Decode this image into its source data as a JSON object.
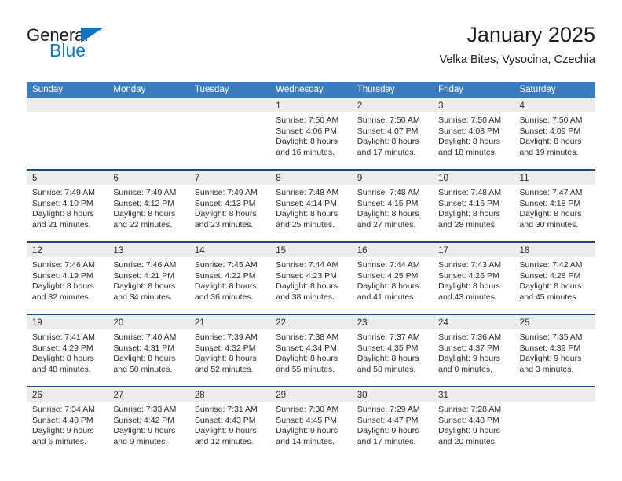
{
  "logo": {
    "word_top": "General",
    "word_bottom": "Blue",
    "triangle_color": "#1574bb",
    "blue_color": "#1574bb"
  },
  "header": {
    "title": "January 2025",
    "subtitle": "Velka Bites, Vysocina, Czechia"
  },
  "theme": {
    "header_bar": "#3a7cbe",
    "row_divider": "#1f4e79",
    "day_head_bg": "#ececec"
  },
  "calendar": {
    "weekday_headers": [
      "Sunday",
      "Monday",
      "Tuesday",
      "Wednesday",
      "Thursday",
      "Friday",
      "Saturday"
    ],
    "weeks": [
      [
        {
          "day": "",
          "empty": true
        },
        {
          "day": "",
          "empty": true
        },
        {
          "day": "",
          "empty": true
        },
        {
          "day": "1",
          "sunrise": "Sunrise: 7:50 AM",
          "sunset": "Sunset: 4:06 PM",
          "daylight1": "Daylight: 8 hours",
          "daylight2": "and 16 minutes."
        },
        {
          "day": "2",
          "sunrise": "Sunrise: 7:50 AM",
          "sunset": "Sunset: 4:07 PM",
          "daylight1": "Daylight: 8 hours",
          "daylight2": "and 17 minutes."
        },
        {
          "day": "3",
          "sunrise": "Sunrise: 7:50 AM",
          "sunset": "Sunset: 4:08 PM",
          "daylight1": "Daylight: 8 hours",
          "daylight2": "and 18 minutes."
        },
        {
          "day": "4",
          "sunrise": "Sunrise: 7:50 AM",
          "sunset": "Sunset: 4:09 PM",
          "daylight1": "Daylight: 8 hours",
          "daylight2": "and 19 minutes."
        }
      ],
      [
        {
          "day": "5",
          "sunrise": "Sunrise: 7:49 AM",
          "sunset": "Sunset: 4:10 PM",
          "daylight1": "Daylight: 8 hours",
          "daylight2": "and 21 minutes."
        },
        {
          "day": "6",
          "sunrise": "Sunrise: 7:49 AM",
          "sunset": "Sunset: 4:12 PM",
          "daylight1": "Daylight: 8 hours",
          "daylight2": "and 22 minutes."
        },
        {
          "day": "7",
          "sunrise": "Sunrise: 7:49 AM",
          "sunset": "Sunset: 4:13 PM",
          "daylight1": "Daylight: 8 hours",
          "daylight2": "and 23 minutes."
        },
        {
          "day": "8",
          "sunrise": "Sunrise: 7:48 AM",
          "sunset": "Sunset: 4:14 PM",
          "daylight1": "Daylight: 8 hours",
          "daylight2": "and 25 minutes."
        },
        {
          "day": "9",
          "sunrise": "Sunrise: 7:48 AM",
          "sunset": "Sunset: 4:15 PM",
          "daylight1": "Daylight: 8 hours",
          "daylight2": "and 27 minutes."
        },
        {
          "day": "10",
          "sunrise": "Sunrise: 7:48 AM",
          "sunset": "Sunset: 4:16 PM",
          "daylight1": "Daylight: 8 hours",
          "daylight2": "and 28 minutes."
        },
        {
          "day": "11",
          "sunrise": "Sunrise: 7:47 AM",
          "sunset": "Sunset: 4:18 PM",
          "daylight1": "Daylight: 8 hours",
          "daylight2": "and 30 minutes."
        }
      ],
      [
        {
          "day": "12",
          "sunrise": "Sunrise: 7:46 AM",
          "sunset": "Sunset: 4:19 PM",
          "daylight1": "Daylight: 8 hours",
          "daylight2": "and 32 minutes."
        },
        {
          "day": "13",
          "sunrise": "Sunrise: 7:46 AM",
          "sunset": "Sunset: 4:21 PM",
          "daylight1": "Daylight: 8 hours",
          "daylight2": "and 34 minutes."
        },
        {
          "day": "14",
          "sunrise": "Sunrise: 7:45 AM",
          "sunset": "Sunset: 4:22 PM",
          "daylight1": "Daylight: 8 hours",
          "daylight2": "and 36 minutes."
        },
        {
          "day": "15",
          "sunrise": "Sunrise: 7:44 AM",
          "sunset": "Sunset: 4:23 PM",
          "daylight1": "Daylight: 8 hours",
          "daylight2": "and 38 minutes."
        },
        {
          "day": "16",
          "sunrise": "Sunrise: 7:44 AM",
          "sunset": "Sunset: 4:25 PM",
          "daylight1": "Daylight: 8 hours",
          "daylight2": "and 41 minutes."
        },
        {
          "day": "17",
          "sunrise": "Sunrise: 7:43 AM",
          "sunset": "Sunset: 4:26 PM",
          "daylight1": "Daylight: 8 hours",
          "daylight2": "and 43 minutes."
        },
        {
          "day": "18",
          "sunrise": "Sunrise: 7:42 AM",
          "sunset": "Sunset: 4:28 PM",
          "daylight1": "Daylight: 8 hours",
          "daylight2": "and 45 minutes."
        }
      ],
      [
        {
          "day": "19",
          "sunrise": "Sunrise: 7:41 AM",
          "sunset": "Sunset: 4:29 PM",
          "daylight1": "Daylight: 8 hours",
          "daylight2": "and 48 minutes."
        },
        {
          "day": "20",
          "sunrise": "Sunrise: 7:40 AM",
          "sunset": "Sunset: 4:31 PM",
          "daylight1": "Daylight: 8 hours",
          "daylight2": "and 50 minutes."
        },
        {
          "day": "21",
          "sunrise": "Sunrise: 7:39 AM",
          "sunset": "Sunset: 4:32 PM",
          "daylight1": "Daylight: 8 hours",
          "daylight2": "and 52 minutes."
        },
        {
          "day": "22",
          "sunrise": "Sunrise: 7:38 AM",
          "sunset": "Sunset: 4:34 PM",
          "daylight1": "Daylight: 8 hours",
          "daylight2": "and 55 minutes."
        },
        {
          "day": "23",
          "sunrise": "Sunrise: 7:37 AM",
          "sunset": "Sunset: 4:35 PM",
          "daylight1": "Daylight: 8 hours",
          "daylight2": "and 58 minutes."
        },
        {
          "day": "24",
          "sunrise": "Sunrise: 7:36 AM",
          "sunset": "Sunset: 4:37 PM",
          "daylight1": "Daylight: 9 hours",
          "daylight2": "and 0 minutes."
        },
        {
          "day": "25",
          "sunrise": "Sunrise: 7:35 AM",
          "sunset": "Sunset: 4:39 PM",
          "daylight1": "Daylight: 9 hours",
          "daylight2": "and 3 minutes."
        }
      ],
      [
        {
          "day": "26",
          "sunrise": "Sunrise: 7:34 AM",
          "sunset": "Sunset: 4:40 PM",
          "daylight1": "Daylight: 9 hours",
          "daylight2": "and 6 minutes."
        },
        {
          "day": "27",
          "sunrise": "Sunrise: 7:33 AM",
          "sunset": "Sunset: 4:42 PM",
          "daylight1": "Daylight: 9 hours",
          "daylight2": "and 9 minutes."
        },
        {
          "day": "28",
          "sunrise": "Sunrise: 7:31 AM",
          "sunset": "Sunset: 4:43 PM",
          "daylight1": "Daylight: 9 hours",
          "daylight2": "and 12 minutes."
        },
        {
          "day": "29",
          "sunrise": "Sunrise: 7:30 AM",
          "sunset": "Sunset: 4:45 PM",
          "daylight1": "Daylight: 9 hours",
          "daylight2": "and 14 minutes."
        },
        {
          "day": "30",
          "sunrise": "Sunrise: 7:29 AM",
          "sunset": "Sunset: 4:47 PM",
          "daylight1": "Daylight: 9 hours",
          "daylight2": "and 17 minutes."
        },
        {
          "day": "31",
          "sunrise": "Sunrise: 7:28 AM",
          "sunset": "Sunset: 4:48 PM",
          "daylight1": "Daylight: 9 hours",
          "daylight2": "and 20 minutes."
        },
        {
          "day": "",
          "empty": true
        }
      ]
    ]
  }
}
